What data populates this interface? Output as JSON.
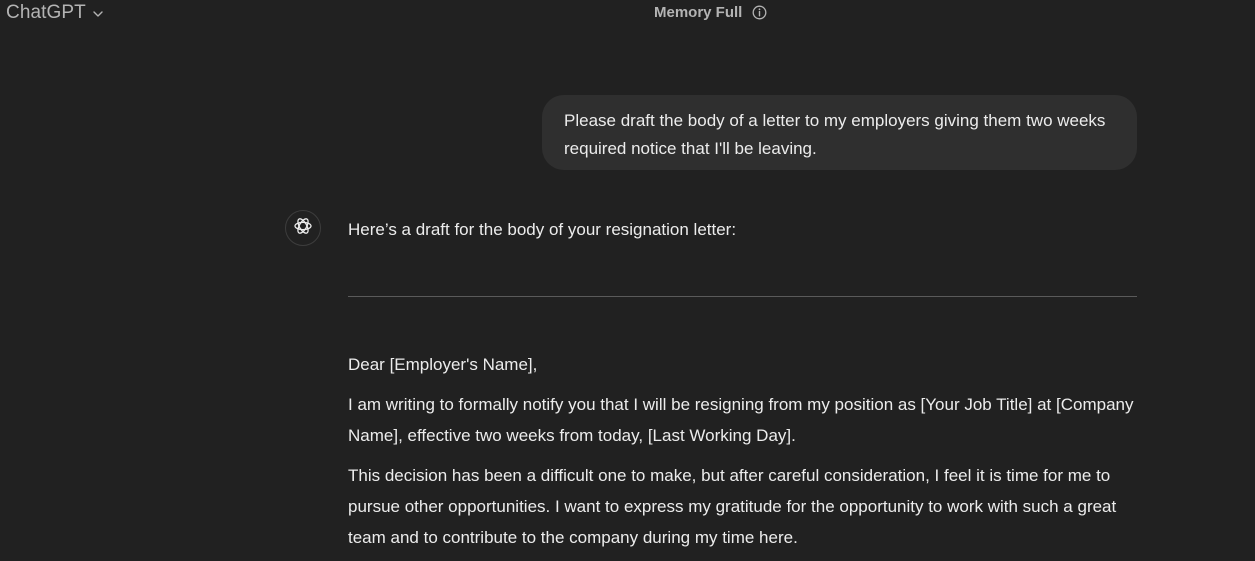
{
  "header": {
    "model_name": "ChatGPT",
    "memory_status": "Memory Full"
  },
  "conversation": {
    "user_message": "Please draft the body of a letter to my employers giving them two weeks required notice that I'll be leaving.",
    "assistant": {
      "intro": "Here’s a draft for the body of your resignation letter:",
      "letter": [
        "Dear [Employer's Name],",
        "I am writing to formally notify you that I will be resigning from my position as [Your Job Title] at [Company Name], effective two weeks from today, [Last Working Day].",
        "This decision has been a difficult one to make, but after careful consideration, I feel it is time for me to pursue other opportunities. I want to express my gratitude for the opportunity to work with such a great team and to contribute to the company during my time here."
      ]
    }
  },
  "icons": {
    "model_dropdown": "chevron-down-icon",
    "memory_info": "info-icon",
    "assistant_avatar": "openai-logo-icon"
  },
  "colors": {
    "background": "#212121",
    "user_bubble": "#2f2f2f",
    "text": "#ececec",
    "muted_text": "#b4b4b4",
    "divider": "#5a5a5a"
  }
}
